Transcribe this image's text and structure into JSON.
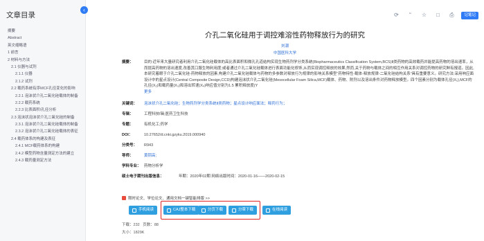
{
  "sidebar": {
    "title": "文章目录",
    "collapse_icon": "chevron-left-icon",
    "items": [
      {
        "label": "摘要",
        "level": 1
      },
      {
        "label": "Abstract",
        "level": 1
      },
      {
        "label": "英文缩略语",
        "level": 1
      },
      {
        "label": "1 前言",
        "level": 1
      },
      {
        "label": "2 材料与方法",
        "level": 1
      },
      {
        "label": "2.1 仪器与试剂",
        "level": 2
      },
      {
        "label": "2.1.1 仪器",
        "level": 3
      },
      {
        "label": "2.1.2 试剂",
        "level": 3
      },
      {
        "label": "2.2 载药系统有序MCF孔径变化的影响",
        "level": 2
      },
      {
        "label": "2.2.1 泡沫状介孔二氧化硅载体的制备",
        "level": 3
      },
      {
        "label": "2.2.2 载药系统",
        "level": 3
      },
      {
        "label": "2.2.3 比表面积/孔径分析",
        "level": 3
      },
      {
        "label": "2.3 泡沫状泡沫状介孔二氧化硅的制备",
        "level": 2
      },
      {
        "label": "2.3.1 泡沫状介孔二氧化硅载体的制备",
        "level": 3
      },
      {
        "label": "2.3.2 泡沫状介孔二氧化硅载体的表征",
        "level": 3
      },
      {
        "label": "2.4 载药体系的构建及表征",
        "level": 2
      },
      {
        "label": "2.4.1 MCF载药体系的构建",
        "level": 3
      },
      {
        "label": "2.4.2 模型药物含量测定方法的建立",
        "level": 3
      },
      {
        "label": "2.4.3 载药量测定方法",
        "level": 3
      }
    ]
  },
  "toolbar": {
    "icons": [
      "share-icon",
      "quote-icon",
      "star-icon",
      "bookmark-icon",
      "print-icon"
    ],
    "remember_label": "记笔记"
  },
  "article": {
    "title": "介孔二氧化硅用于调控难溶性药物释放行为的研究",
    "author": "刘潮",
    "org": "中国医科大学",
    "abstract_label": "摘要：",
    "abstract": "目的:近年来大量研究者利用介孔二氧化硅载体的高比表面积和微孔孔道结构实现生物药剂学分类系统(Biopharmaceutics Classification System,BCS)Ⅱ类药物的高效载药并能提高药物的溶出速率，从而提高药物的溶出速度,改善其口服生物利用度;或者通过介孔二氧化硅载体进行表面功能化修饰,从而实现调控释放的效果,然而,关于药物与载体之间的相互作用关系对调控药物的研究鲜有报道。因此,本研究着眼于介孔二氧化硅-药物释放的因素,构建介孔二氧化硅载体与药物的多参数对释放行为规律的影响关系模型“药物特性-载体-释放规律-二氧化硅结构关系”具有重要意义。研究方法:采用响应面设计中的星点设计(Central Composite Design,CCD)构建泡沫状介孔二氧化硅(Mesocellular Foam Silica,MCF)载体、药物、附剂以及溶出条件对药物释放模型。四个因素分别为载体孔径(X₁),MCF的孔径(X₂)和载药量(X₃)和溶出转速(X₄)响应值分别为1.5 累积释放度(Y",
    "more": "更多",
    "keywords_label": "关键词：",
    "keywords": "泡沫状介孔二氧化硅；生物药剂学分类系统Ⅱ类药物；星点设计响应面法；释药行为；",
    "journal_label": "专辑：",
    "journal": "工程科技Ⅰ辑;医药卫生科技",
    "topic_label": "专题：",
    "topic": "有机化工;药学",
    "doi_label": "DOI：",
    "doi": "10.27652/d.cnki.gzyku.2019.000940",
    "class_label": "分类号：",
    "class_no": "R943",
    "advisor_label": "导师：",
    "advisor": "黄钥高;",
    "major_label": "学科专业：",
    "major": "药物分析学",
    "pub_label": "硕士电子期刊出版信息：",
    "pub": "年期：2020年02期     网络出版时间：2020-01-16——2020-02-15"
  },
  "notice": "限时论文、学位论文、通用文档一键智能排版 >>",
  "buttons": [
    {
      "label": "手机阅读",
      "icon": "phone-icon"
    },
    {
      "label": "CAJ整本下载",
      "icon": "download-icon"
    },
    {
      "label": "分页下载",
      "icon": "download-icon"
    },
    {
      "label": "分章下载",
      "icon": "download-icon"
    },
    {
      "label": "在线阅读",
      "icon": "read-icon"
    }
  ],
  "stats": {
    "downloads_label": "下载：",
    "downloads": "232",
    "pages_label": "页数：",
    "pages": "88",
    "size_label": "大小：",
    "size": "1829K"
  },
  "colors": {
    "accent": "#2f7cf6",
    "link": "#2f6fd6",
    "button": "#2f9fe0",
    "highlight": "#e32222"
  }
}
